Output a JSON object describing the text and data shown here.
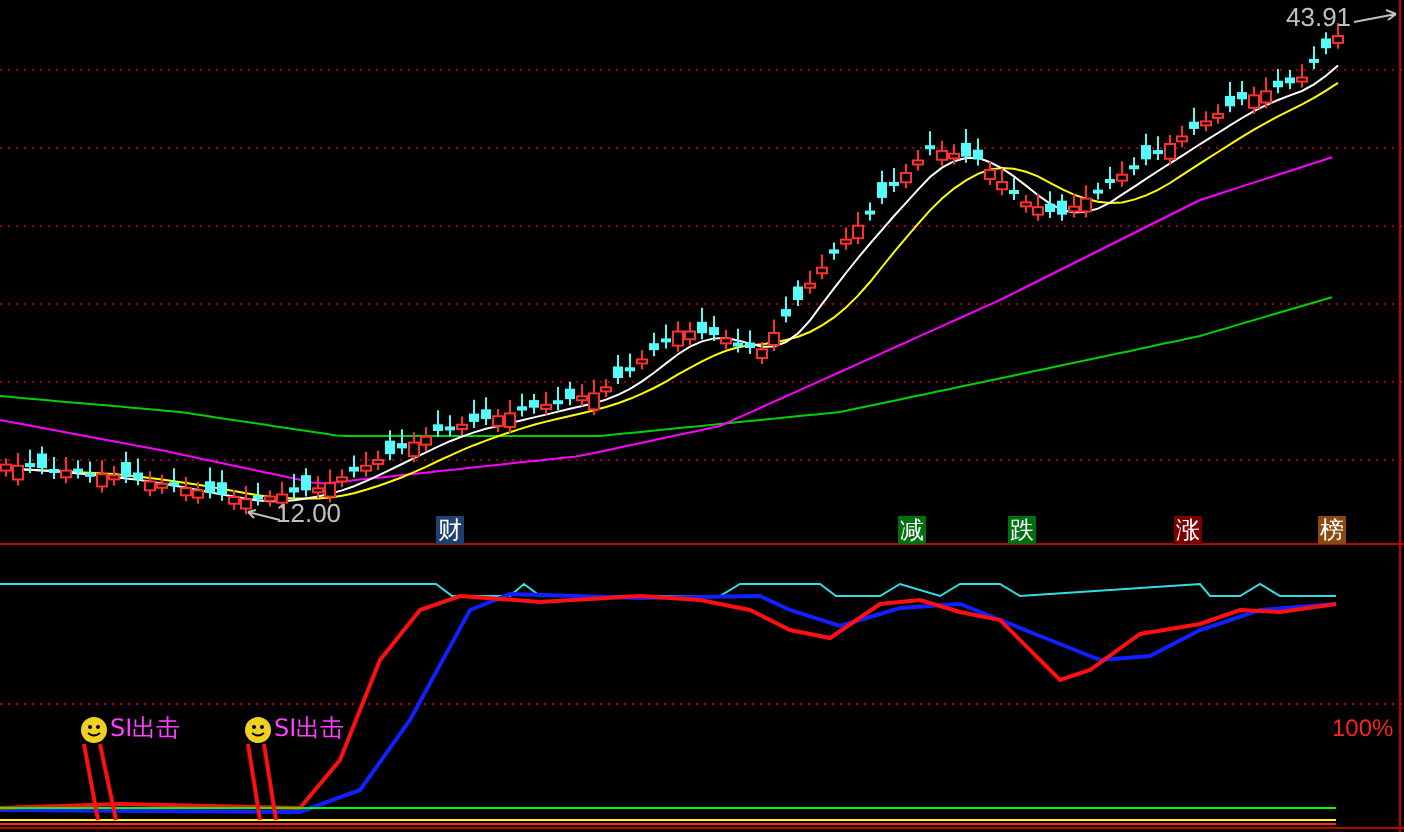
{
  "price_chart": {
    "high_label": "43.91",
    "low_label": "12.00",
    "markers": [
      {
        "label": "财",
        "color": "#1f3f6f"
      },
      {
        "label": "减",
        "color": "#006f10"
      },
      {
        "label": "跌",
        "color": "#006f10"
      },
      {
        "label": "涨",
        "color": "#7a0000"
      },
      {
        "label": "榜",
        "color": "#8a4810"
      }
    ]
  },
  "indicator": {
    "scale_label": "100%",
    "signals": [
      {
        "label": "SI出击"
      },
      {
        "label": "SI出击"
      }
    ]
  }
}
